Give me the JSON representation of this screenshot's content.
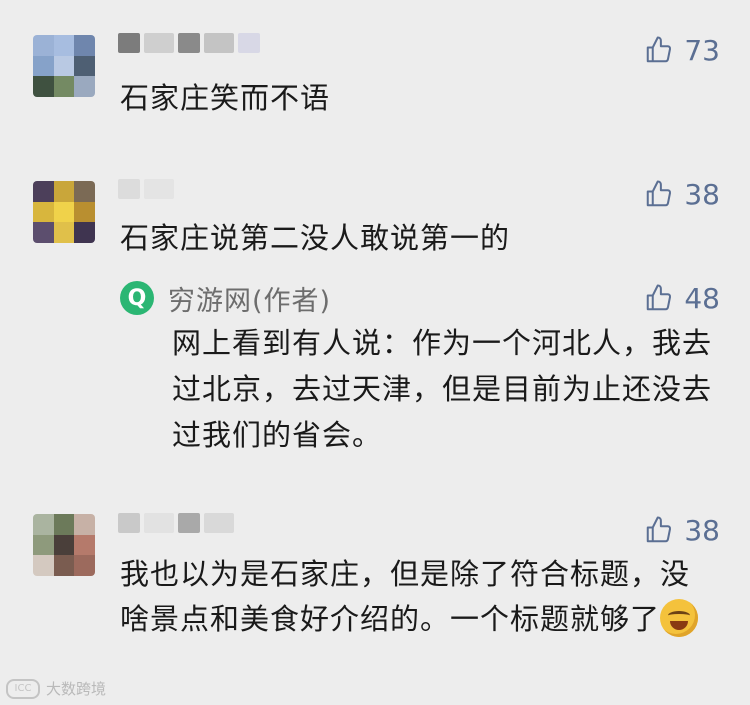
{
  "comments": [
    {
      "likes": "73",
      "text": "石家庄笑而不语",
      "avatar_colors": [
        "#9bb2d6",
        "#a7bde0",
        "#6f86ad",
        "#86a2c9",
        "#b9c9e3",
        "#4e5f73",
        "#3f5140",
        "#748a63",
        "#9aa9bf"
      ],
      "name_blocks": [
        "#7c7c7c",
        "#cfcfcf",
        "#8a8a8a",
        "#c4c4c4",
        "#d8d8e6"
      ]
    },
    {
      "likes": "38",
      "text": "石家庄说第二没人敢说第一的",
      "avatar_colors": [
        "#4c3f5a",
        "#c9a63a",
        "#7b6a55",
        "#d8b63d",
        "#f0d24a",
        "#b98f30",
        "#5c4e6e",
        "#e0c04a",
        "#3f3450"
      ],
      "name_blocks": [
        "#dcdcdc",
        "#e4e4e4"
      ],
      "reply": {
        "author": "穷游网(作者)",
        "logo_letter": "Q",
        "likes": "48",
        "text": "网上看到有人说：作为一个河北人，我去过北京，去过天津，但是目前为止还没去过我们的省会。"
      }
    },
    {
      "likes": "38",
      "text": "我也以为是石家庄，但是除了符合标题，没啥景点和美食好介绍的。一个标题就够了",
      "avatar_colors": [
        "#aab4a0",
        "#6c7a5a",
        "#c7b1a6",
        "#8e9a7c",
        "#4a3f3a",
        "#b57a6b",
        "#d4c9c0",
        "#7a5c50",
        "#9c6a5d"
      ],
      "name_blocks": [
        "#c9c9c9",
        "#e2e2e2",
        "#a9a9a9",
        "#d9d9d9"
      ],
      "emoji": "laughing-crying-emoji"
    }
  ],
  "watermark": {
    "mark": "ICC",
    "text": "大数跨境"
  },
  "colors": {
    "background": "#ededed",
    "like": "#5b6f93",
    "logo": "#2bb673"
  }
}
